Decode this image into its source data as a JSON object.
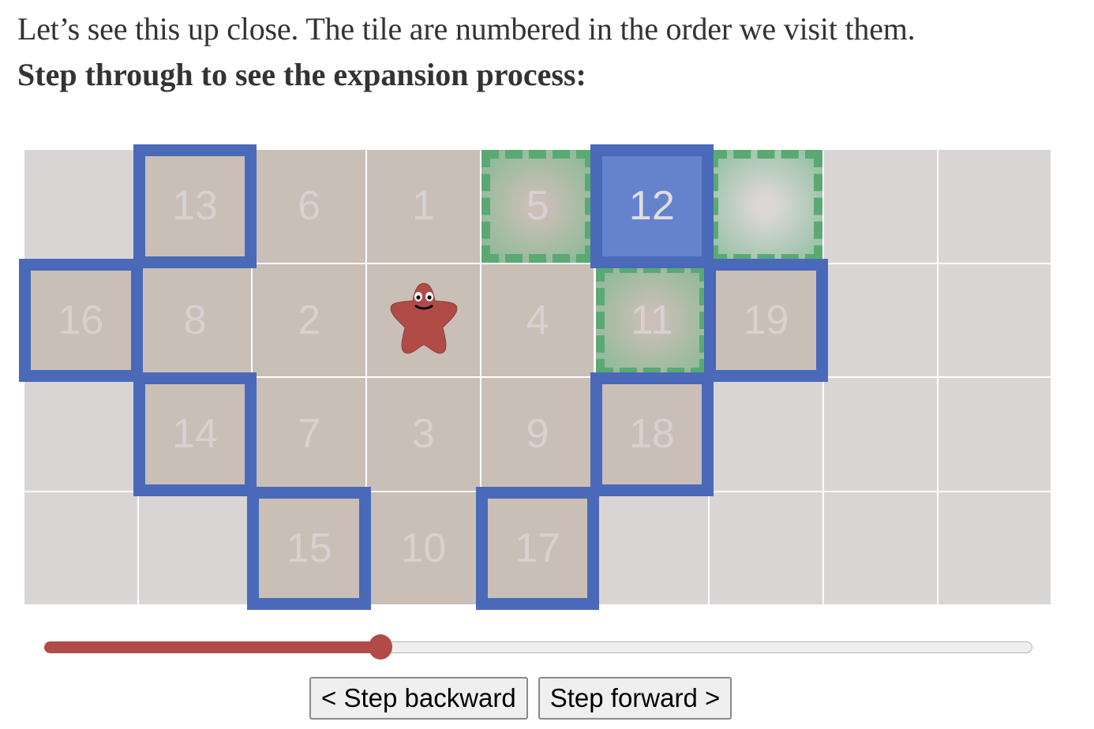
{
  "intro": {
    "line1": "Let’s see this up close. The tile are numbered in the order we visit them.",
    "line2": "Step through to see the expansion process:"
  },
  "grid": {
    "cols": 9,
    "rows": 4,
    "colors": {
      "empty": "#dad5d5",
      "visited": "#c9bfb6",
      "current": "#6483cc",
      "frontier_border": "#4a69b9",
      "neighbor_border": "#5aa973",
      "gridline": "#ffffff",
      "number": "#d8d1d1"
    },
    "tiles": [
      {
        "row": 0,
        "col": 0,
        "label": "",
        "state": "empty"
      },
      {
        "row": 0,
        "col": 1,
        "label": "13",
        "state": "frontier"
      },
      {
        "row": 0,
        "col": 2,
        "label": "6",
        "state": "visited"
      },
      {
        "row": 0,
        "col": 3,
        "label": "1",
        "state": "visited"
      },
      {
        "row": 0,
        "col": 4,
        "label": "5",
        "state": "neighbor-visited"
      },
      {
        "row": 0,
        "col": 5,
        "label": "12",
        "state": "current"
      },
      {
        "row": 0,
        "col": 6,
        "label": "",
        "state": "neighbor-empty"
      },
      {
        "row": 0,
        "col": 7,
        "label": "",
        "state": "empty"
      },
      {
        "row": 0,
        "col": 8,
        "label": "",
        "state": "empty"
      },
      {
        "row": 1,
        "col": 0,
        "label": "16",
        "state": "frontier"
      },
      {
        "row": 1,
        "col": 1,
        "label": "8",
        "state": "visited"
      },
      {
        "row": 1,
        "col": 2,
        "label": "2",
        "state": "visited"
      },
      {
        "row": 1,
        "col": 3,
        "label": "",
        "state": "start"
      },
      {
        "row": 1,
        "col": 4,
        "label": "4",
        "state": "visited"
      },
      {
        "row": 1,
        "col": 5,
        "label": "11",
        "state": "neighbor-visited"
      },
      {
        "row": 1,
        "col": 6,
        "label": "19",
        "state": "frontier"
      },
      {
        "row": 1,
        "col": 7,
        "label": "",
        "state": "empty"
      },
      {
        "row": 1,
        "col": 8,
        "label": "",
        "state": "empty"
      },
      {
        "row": 2,
        "col": 0,
        "label": "",
        "state": "empty"
      },
      {
        "row": 2,
        "col": 1,
        "label": "14",
        "state": "frontier"
      },
      {
        "row": 2,
        "col": 2,
        "label": "7",
        "state": "visited"
      },
      {
        "row": 2,
        "col": 3,
        "label": "3",
        "state": "visited"
      },
      {
        "row": 2,
        "col": 4,
        "label": "9",
        "state": "visited"
      },
      {
        "row": 2,
        "col": 5,
        "label": "18",
        "state": "frontier"
      },
      {
        "row": 2,
        "col": 6,
        "label": "",
        "state": "empty"
      },
      {
        "row": 2,
        "col": 7,
        "label": "",
        "state": "empty"
      },
      {
        "row": 2,
        "col": 8,
        "label": "",
        "state": "empty"
      },
      {
        "row": 3,
        "col": 0,
        "label": "",
        "state": "empty"
      },
      {
        "row": 3,
        "col": 1,
        "label": "",
        "state": "empty"
      },
      {
        "row": 3,
        "col": 2,
        "label": "15",
        "state": "frontier"
      },
      {
        "row": 3,
        "col": 3,
        "label": "10",
        "state": "visited"
      },
      {
        "row": 3,
        "col": 4,
        "label": "17",
        "state": "frontier"
      },
      {
        "row": 3,
        "col": 5,
        "label": "",
        "state": "empty"
      },
      {
        "row": 3,
        "col": 6,
        "label": "",
        "state": "empty"
      },
      {
        "row": 3,
        "col": 7,
        "label": "",
        "state": "empty"
      },
      {
        "row": 3,
        "col": 8,
        "label": "",
        "state": "empty"
      }
    ],
    "character": {
      "icon": "star-blob-character-icon",
      "color": "#b04b47"
    }
  },
  "slider": {
    "value_fraction": 0.34,
    "fill_color": "#b04b47"
  },
  "buttons": {
    "back_label": "< Step backward",
    "forward_label": "Step forward >"
  }
}
